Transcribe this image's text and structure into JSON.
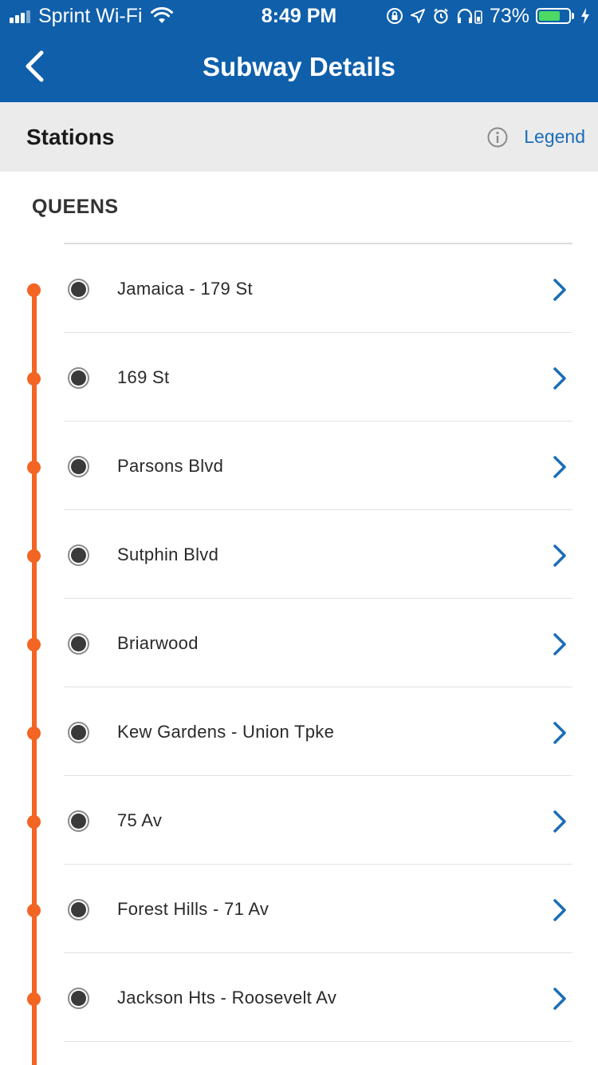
{
  "status_bar": {
    "carrier": "Sprint Wi-Fi",
    "time": "8:49 PM",
    "battery_percent": "73%",
    "battery_level": 0.73,
    "icons": [
      "signal-icon",
      "wifi-icon",
      "orientation-lock-icon",
      "location-arrow-icon",
      "alarm-icon",
      "headphones-icon",
      "battery-icon",
      "charging-bolt-icon"
    ]
  },
  "nav": {
    "title": "Subway Details",
    "back_icon": "back-chevron-icon"
  },
  "section": {
    "title": "Stations",
    "legend_label": "Legend",
    "info_icon": "info-icon"
  },
  "borough": "QUEENS",
  "colors": {
    "header": "#0f5fab",
    "route_line": "#f26522",
    "link": "#1a6db8",
    "section_bg": "#ebebeb"
  },
  "stations": [
    {
      "name": "Jamaica - 179 St"
    },
    {
      "name": "169 St"
    },
    {
      "name": "Parsons Blvd"
    },
    {
      "name": "Sutphin Blvd"
    },
    {
      "name": "Briarwood"
    },
    {
      "name": "Kew Gardens - Union Tpke"
    },
    {
      "name": "75 Av"
    },
    {
      "name": "Forest Hills - 71 Av"
    },
    {
      "name": "Jackson Hts - Roosevelt Av"
    }
  ]
}
